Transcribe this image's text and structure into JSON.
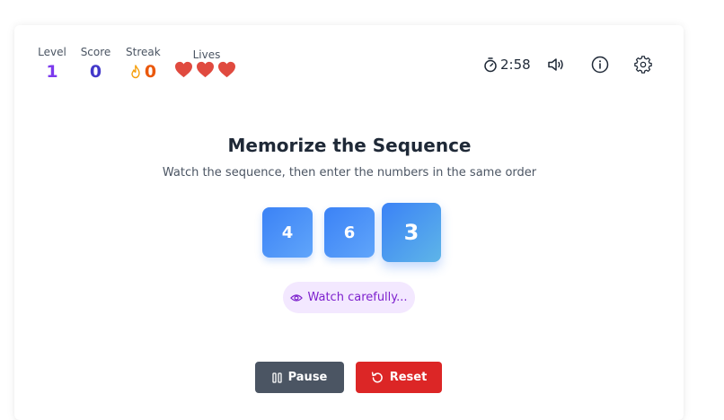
{
  "stats": {
    "level": {
      "label": "Level",
      "value": "1",
      "color": "#7c3aed"
    },
    "score": {
      "label": "Score",
      "value": "0",
      "color": "#4338ca"
    },
    "streak": {
      "label": "Streak",
      "value": "0",
      "color": "#ea580c",
      "icon": "flame-icon"
    },
    "lives": {
      "label": "Lives",
      "count": 3,
      "max": 3,
      "color": "#e04a3f",
      "icon": "heart-icon"
    }
  },
  "toolbar": {
    "timer": "2:58",
    "timer_icon": "stopwatch-icon",
    "sound_icon": "speaker-icon",
    "info_icon": "info-icon",
    "settings_icon": "gear-icon"
  },
  "main": {
    "title": "Memorize the Sequence",
    "subtitle": "Watch the sequence, then enter the numbers in the same order",
    "sequence": [
      "4",
      "6",
      "3"
    ],
    "active_index": 2,
    "status": "Watch carefully...",
    "status_icon": "eye-icon"
  },
  "buttons": {
    "pause_label": "Pause",
    "pause_icon": "pause-icon",
    "reset_label": "Reset",
    "reset_icon": "reset-icon"
  },
  "colors": {
    "tile_accent": "#3b82f6",
    "pause_bg": "#4b5563",
    "reset_bg": "#dc2626",
    "status_bg": "#f3e8ff",
    "status_text": "#7e22ce"
  }
}
